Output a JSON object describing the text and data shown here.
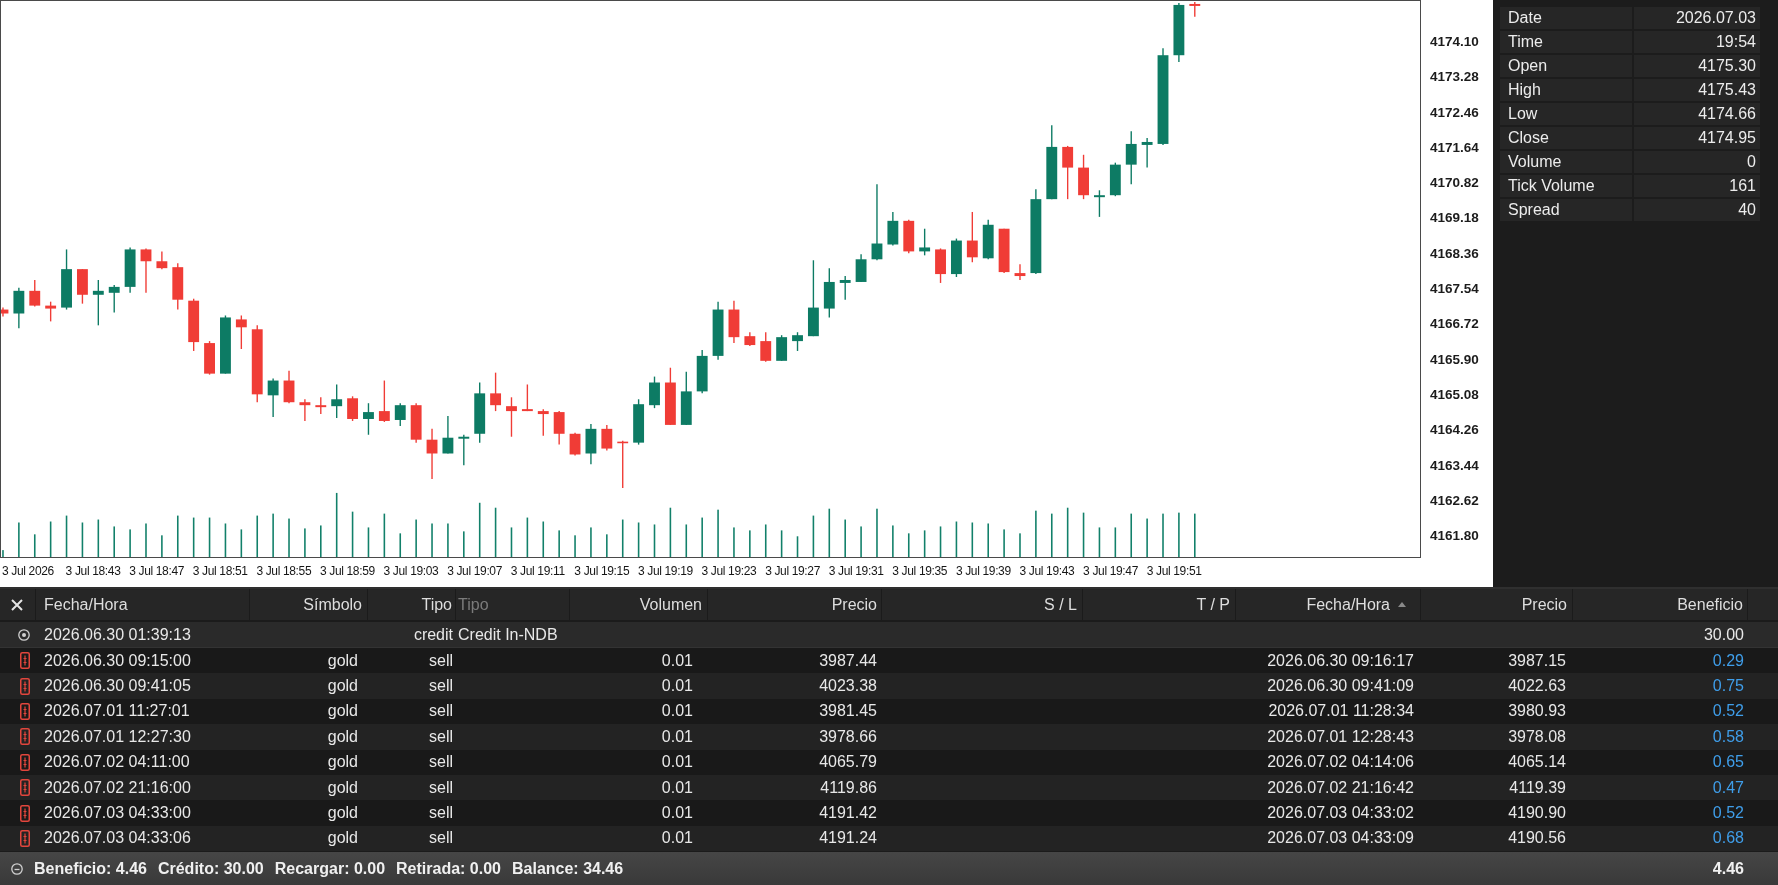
{
  "chart": {
    "price_labels": [
      "4174.10",
      "4173.28",
      "4172.46",
      "4171.64",
      "4170.82",
      "4169.18",
      "4168.36",
      "4167.54",
      "4166.72",
      "4165.90",
      "4165.08",
      "4164.26",
      "4163.44",
      "4162.62",
      "4161.80"
    ],
    "time_labels": [
      "3 Jul 2026",
      "3 Jul 18:43",
      "3 Jul 18:47",
      "3 Jul 18:51",
      "3 Jul 18:55",
      "3 Jul 18:59",
      "3 Jul 19:03",
      "3 Jul 19:07",
      "3 Jul 19:11",
      "3 Jul 19:15",
      "3 Jul 19:19",
      "3 Jul 19:23",
      "3 Jul 19:27",
      "3 Jul 19:31",
      "3 Jul 19:35",
      "3 Jul 19:39",
      "3 Jul 19:43",
      "3 Jul 19:47",
      "3 Jul 19:51"
    ]
  },
  "data_window": [
    {
      "label": "Date",
      "value": "2026.07.03"
    },
    {
      "label": "Time",
      "value": "19:54"
    },
    {
      "label": "Open",
      "value": "4175.30"
    },
    {
      "label": "High",
      "value": "4175.43"
    },
    {
      "label": "Low",
      "value": "4174.66"
    },
    {
      "label": "Close",
      "value": "4174.95"
    },
    {
      "label": "Volume",
      "value": "0"
    },
    {
      "label": "Tick Volume",
      "value": "161"
    },
    {
      "label": "Spread",
      "value": "40"
    }
  ],
  "history": {
    "columns": [
      {
        "label": "Fecha/Hora",
        "sorted": false,
        "dimmed": false
      },
      {
        "label": "Símbolo",
        "sorted": false,
        "dimmed": false
      },
      {
        "label": "Tipo",
        "sorted": false,
        "dimmed": false
      },
      {
        "label": "Tipo",
        "sorted": false,
        "dimmed": true
      },
      {
        "label": "Volumen",
        "sorted": false,
        "dimmed": false
      },
      {
        "label": "Precio",
        "sorted": false,
        "dimmed": false
      },
      {
        "label": "S / L",
        "sorted": false,
        "dimmed": false
      },
      {
        "label": "T / P",
        "sorted": false,
        "dimmed": false
      },
      {
        "label": "Fecha/Hora",
        "sorted": true,
        "dimmed": false
      },
      {
        "label": "Precio",
        "sorted": false,
        "dimmed": false
      },
      {
        "label": "Beneficio",
        "sorted": false,
        "dimmed": false
      }
    ],
    "rows": [
      {
        "kind": "credit",
        "open_time": "2026.06.30 01:39:13",
        "type": "credit",
        "comment": "Credit In-NDB",
        "profit": "30.00"
      },
      {
        "kind": "deal",
        "open_time": "2026.06.30 09:15:00",
        "symbol": "gold",
        "type": "sell",
        "volume": "0.01",
        "open_price": "3987.44",
        "close_time": "2026.06.30 09:16:17",
        "close_price": "3987.15",
        "profit": "0.29"
      },
      {
        "kind": "deal",
        "open_time": "2026.06.30 09:41:05",
        "symbol": "gold",
        "type": "sell",
        "volume": "0.01",
        "open_price": "4023.38",
        "close_time": "2026.06.30 09:41:09",
        "close_price": "4022.63",
        "profit": "0.75"
      },
      {
        "kind": "deal",
        "open_time": "2026.07.01 11:27:01",
        "symbol": "gold",
        "type": "sell",
        "volume": "0.01",
        "open_price": "3981.45",
        "close_time": "2026.07.01 11:28:34",
        "close_price": "3980.93",
        "profit": "0.52"
      },
      {
        "kind": "deal",
        "open_time": "2026.07.01 12:27:30",
        "symbol": "gold",
        "type": "sell",
        "volume": "0.01",
        "open_price": "3978.66",
        "close_time": "2026.07.01 12:28:43",
        "close_price": "3978.08",
        "profit": "0.58"
      },
      {
        "kind": "deal",
        "open_time": "2026.07.02 04:11:00",
        "symbol": "gold",
        "type": "sell",
        "volume": "0.01",
        "open_price": "4065.79",
        "close_time": "2026.07.02 04:14:06",
        "close_price": "4065.14",
        "profit": "0.65"
      },
      {
        "kind": "deal",
        "open_time": "2026.07.02 21:16:00",
        "symbol": "gold",
        "type": "sell",
        "volume": "0.01",
        "open_price": "4119.86",
        "close_time": "2026.07.02 21:16:42",
        "close_price": "4119.39",
        "profit": "0.47"
      },
      {
        "kind": "deal",
        "open_time": "2026.07.03 04:33:00",
        "symbol": "gold",
        "type": "sell",
        "volume": "0.01",
        "open_price": "4191.42",
        "close_time": "2026.07.03 04:33:02",
        "close_price": "4190.90",
        "profit": "0.52"
      },
      {
        "kind": "deal",
        "open_time": "2026.07.03 04:33:06",
        "symbol": "gold",
        "type": "sell",
        "volume": "0.01",
        "open_price": "4191.24",
        "close_time": "2026.07.03 04:33:09",
        "close_price": "4190.56",
        "profit": "0.68"
      }
    ]
  },
  "footer": {
    "summary": [
      "Beneficio: 4.46",
      "Crédito: 30.00",
      "Recargar: 0.00",
      "Retirada: 0.00",
      "Balance: 34.46"
    ],
    "total": "4.46"
  }
}
